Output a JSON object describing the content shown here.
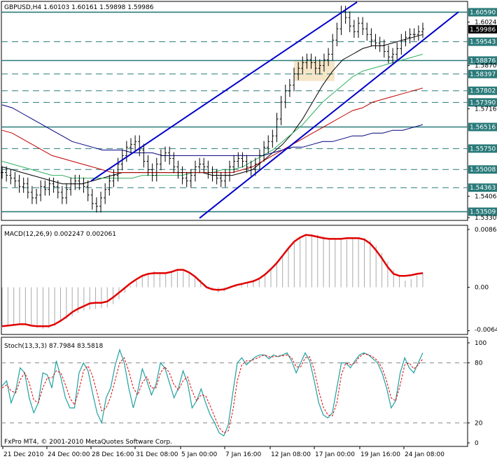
{
  "chart_data": [
    {
      "type": "line",
      "panel": "price",
      "title": "GBPUSD,H4  1.60103 1.60161 1.59898 1.59986",
      "ohlc": {
        "open": 1.60103,
        "high": 1.60161,
        "low": 1.59898,
        "close": 1.59986
      },
      "ylim": [
        1.5325,
        1.609
      ],
      "y_tick_labels": [
        "1.60240",
        "1.59986",
        "1.59543",
        "1.58876",
        "1.58700",
        "1.58397",
        "1.57802",
        "1.57390",
        "1.57160",
        "1.56516",
        "1.55750",
        "1.55008",
        "1.54060",
        "1.54363",
        "1.53509",
        "1.53300"
      ],
      "horizontal_levels": [
        {
          "label": "1.60590",
          "value": 1.6059,
          "style": "solid"
        },
        {
          "label": "1.59543",
          "value": 1.59543,
          "style": "dashed"
        },
        {
          "label": "1.58876",
          "value": 1.58876,
          "style": "solid"
        },
        {
          "label": "1.58397",
          "value": 1.58397,
          "style": "dashed"
        },
        {
          "label": "1.57802",
          "value": 1.57802,
          "style": "dashed"
        },
        {
          "label": "1.57390",
          "value": 1.5739,
          "style": "dashed"
        },
        {
          "label": "1.56516",
          "value": 1.56516,
          "style": "solid"
        },
        {
          "label": "1.55750",
          "value": 1.5575,
          "style": "dashed"
        },
        {
          "label": "1.55008",
          "value": 1.55008,
          "style": "dashed"
        },
        {
          "label": "1.54363",
          "value": 1.54363,
          "style": "dashed"
        },
        {
          "label": "1.53509",
          "value": 1.53509,
          "style": "solid"
        }
      ],
      "current_price": {
        "label": "1.59986",
        "value": 1.59986
      },
      "close_series": [
        1.549,
        1.548,
        1.547,
        1.546,
        1.544,
        1.545,
        1.542,
        1.54,
        1.541,
        1.544,
        1.543,
        1.545,
        1.544,
        1.542,
        1.54,
        1.543,
        1.545,
        1.546,
        1.545,
        1.544,
        1.541,
        1.538,
        1.537,
        1.54,
        1.543,
        1.546,
        1.548,
        1.552,
        1.555,
        1.558,
        1.559,
        1.56,
        1.557,
        1.553,
        1.55,
        1.548,
        1.552,
        1.555,
        1.556,
        1.554,
        1.551,
        1.549,
        1.547,
        1.546,
        1.548,
        1.551,
        1.552,
        1.551,
        1.549,
        1.548,
        1.547,
        1.546,
        1.548,
        1.551,
        1.553,
        1.554,
        1.553,
        1.551,
        1.55,
        1.552,
        1.555,
        1.558,
        1.56,
        1.562,
        1.568,
        1.574,
        1.578,
        1.58,
        1.584,
        1.586,
        1.588,
        1.589,
        1.588,
        1.586,
        1.587,
        1.589,
        1.591,
        1.596,
        1.6,
        1.606,
        1.604,
        1.601,
        1.599,
        1.602,
        1.6,
        1.598,
        1.596,
        1.595,
        1.594,
        1.592,
        1.59,
        1.591,
        1.593,
        1.596,
        1.597,
        1.598,
        1.598,
        1.599,
        1.6
      ],
      "moving_averages": [
        {
          "color": "#000000",
          "values": [
            1.551,
            1.55,
            1.549,
            1.548,
            1.547,
            1.546,
            1.545,
            1.545,
            1.545,
            1.546,
            1.547,
            1.548,
            1.549,
            1.549,
            1.549,
            1.549,
            1.549,
            1.549,
            1.549,
            1.549,
            1.549,
            1.548,
            1.548,
            1.548,
            1.549,
            1.55,
            1.553,
            1.556,
            1.559,
            1.563,
            1.568,
            1.574,
            1.58,
            1.585,
            1.589,
            1.591,
            1.593,
            1.594,
            1.594,
            1.595,
            1.596,
            1.597,
            1.598
          ]
        },
        {
          "color": "#30b060",
          "values": [
            1.553,
            1.552,
            1.551,
            1.55,
            1.549,
            1.548,
            1.548,
            1.547,
            1.547,
            1.547,
            1.547,
            1.547,
            1.547,
            1.547,
            1.548,
            1.548,
            1.548,
            1.548,
            1.548,
            1.549,
            1.549,
            1.549,
            1.55,
            1.55,
            1.551,
            1.553,
            1.555,
            1.557,
            1.56,
            1.563,
            1.566,
            1.57,
            1.574,
            1.577,
            1.58,
            1.583,
            1.585,
            1.586,
            1.587,
            1.588,
            1.589,
            1.59,
            1.591
          ]
        },
        {
          "color": "#c00000",
          "values": [
            1.564,
            1.563,
            1.561,
            1.559,
            1.557,
            1.555,
            1.554,
            1.553,
            1.552,
            1.551,
            1.55,
            1.549,
            1.549,
            1.549,
            1.549,
            1.549,
            1.549,
            1.549,
            1.549,
            1.549,
            1.549,
            1.549,
            1.549,
            1.549,
            1.55,
            1.551,
            1.553,
            1.555,
            1.557,
            1.559,
            1.561,
            1.563,
            1.565,
            1.567,
            1.569,
            1.571,
            1.572,
            1.574,
            1.575,
            1.576,
            1.577,
            1.578,
            1.579
          ]
        },
        {
          "color": "#000080",
          "values": [
            1.573,
            1.572,
            1.57,
            1.568,
            1.566,
            1.564,
            1.562,
            1.56,
            1.559,
            1.558,
            1.557,
            1.557,
            1.557,
            1.556,
            1.556,
            1.556,
            1.555,
            1.555,
            1.555,
            1.555,
            1.555,
            1.555,
            1.555,
            1.555,
            1.555,
            1.555,
            1.555,
            1.556,
            1.557,
            1.558,
            1.558,
            1.559,
            1.56,
            1.56,
            1.561,
            1.562,
            1.562,
            1.563,
            1.563,
            1.564,
            1.564,
            1.565,
            1.566
          ]
        }
      ]
    },
    {
      "type": "bar",
      "panel": "macd",
      "title": "MACD(12,26,9) 0.002247 0.002061",
      "values": {
        "main": 0.002247,
        "signal": 0.002061
      },
      "ylim": [
        -0.0066,
        0.0088
      ],
      "y_tick_labels": [
        "0.00860",
        "0.00",
        "-0.00646"
      ],
      "histogram": [
        -0.0058,
        -0.0057,
        -0.0055,
        -0.0054,
        -0.0056,
        -0.0058,
        -0.006,
        -0.0062,
        -0.0061,
        -0.0058,
        -0.0052,
        -0.0047,
        -0.0043,
        -0.0038,
        -0.0035,
        -0.0033,
        -0.0032,
        -0.0031,
        -0.003,
        -0.0025,
        -0.0018,
        -0.0008,
        0.0002,
        0.001,
        0.0016,
        0.002,
        0.0024,
        0.0022,
        0.0021,
        0.0022,
        0.0025,
        0.0026,
        0.0022,
        0.0016,
        0.0011,
        0.0002,
        -0.0004,
        -0.0008,
        -0.0006,
        -0.0002,
        0.0003,
        0.0006,
        0.0008,
        0.0011,
        0.0014,
        0.002,
        0.0028,
        0.0036,
        0.0046,
        0.0058,
        0.0068,
        0.0075,
        0.0078,
        0.0079,
        0.0078,
        0.0076,
        0.0073,
        0.0072,
        0.0071,
        0.0071,
        0.0072,
        0.0073,
        0.0073,
        0.007,
        0.0062,
        0.0051,
        0.0038,
        0.0026,
        0.0016,
        0.001,
        0.0012,
        0.0018,
        0.0022
      ],
      "signal_line": [
        -0.0058,
        -0.0057,
        -0.0056,
        -0.0055,
        -0.0055,
        -0.0057,
        -0.0058,
        -0.0058,
        -0.0058,
        -0.0055,
        -0.005,
        -0.0044,
        -0.0037,
        -0.0032,
        -0.0028,
        -0.0024,
        -0.0023,
        -0.0023,
        -0.0021,
        -0.0015,
        -0.0008,
        -0.0001,
        0.0006,
        0.0012,
        0.0017,
        0.002,
        0.0021,
        0.0021,
        0.0021,
        0.0023,
        0.0026,
        0.0026,
        0.0022,
        0.0016,
        0.0008,
        0.0,
        -0.0003,
        -0.0004,
        -0.0003,
        0.0,
        0.0003,
        0.0005,
        0.0007,
        0.0009,
        0.0013,
        0.0019,
        0.0027,
        0.0036,
        0.0047,
        0.0058,
        0.0068,
        0.0074,
        0.0078,
        0.0077,
        0.0075,
        0.0073,
        0.0072,
        0.0072,
        0.0072,
        0.0073,
        0.0073,
        0.0073,
        0.0071,
        0.0065,
        0.0055,
        0.0043,
        0.003,
        0.002,
        0.0017,
        0.0017,
        0.0018,
        0.002,
        0.0021
      ]
    },
    {
      "type": "line",
      "panel": "stochastic",
      "title": "Stoch(13,3,3) 87.7984 83.5818",
      "values": {
        "main": 87.7984,
        "signal": 83.5818
      },
      "ylim": [
        0,
        100
      ],
      "y_tick_labels": [
        "100",
        "80",
        "20",
        "0"
      ],
      "main": [
        57,
        62,
        40,
        52,
        75,
        70,
        45,
        30,
        40,
        70,
        68,
        55,
        82,
        65,
        45,
        35,
        35,
        70,
        80,
        72,
        50,
        30,
        20,
        45,
        55,
        78,
        93,
        80,
        55,
        35,
        52,
        74,
        62,
        48,
        58,
        80,
        75,
        60,
        45,
        55,
        72,
        60,
        35,
        42,
        54,
        40,
        28,
        20,
        10,
        7,
        18,
        50,
        80,
        85,
        78,
        82,
        86,
        88,
        88,
        84,
        88,
        86,
        88,
        90,
        82,
        70,
        80,
        90,
        82,
        62,
        40,
        28,
        25,
        30,
        55,
        80,
        80,
        75,
        82,
        88,
        90,
        88,
        84,
        80,
        70,
        55,
        35,
        42,
        70,
        85,
        75,
        70,
        80,
        90
      ],
      "signal": [
        55,
        58,
        52,
        50,
        63,
        70,
        60,
        43,
        40,
        55,
        65,
        65,
        72,
        70,
        58,
        45,
        38,
        53,
        72,
        77,
        67,
        50,
        32,
        35,
        46,
        63,
        80,
        85,
        72,
        55,
        48,
        60,
        66,
        55,
        55,
        70,
        76,
        70,
        58,
        53,
        62,
        66,
        52,
        42,
        48,
        47,
        37,
        26,
        15,
        10,
        12,
        32,
        62,
        78,
        82,
        82,
        84,
        86,
        88,
        86,
        86,
        87,
        87,
        88,
        85,
        76,
        76,
        85,
        86,
        73,
        52,
        36,
        28,
        27,
        40,
        68,
        80,
        78,
        80,
        86,
        89,
        88,
        86,
        82,
        75,
        62,
        45,
        42,
        58,
        78,
        80,
        74,
        78,
        84
      ]
    },
    {
      "type": "table",
      "panel": "time-axis",
      "x_tick_labels": [
        "21 Dec 2010",
        "24 Dec 00:00",
        "28 Dec 16:00",
        "31 Dec 08:00",
        "5 Jan 00:00",
        "7 Jan 16:00",
        "12 Jan 08:00",
        "17 Jan 00:00",
        "19 Jan 16:00",
        "24 Jan 08:00"
      ]
    }
  ],
  "footer": {
    "copyright": "FxPro MT4, © 2001-2010 MetaQuotes Software Corp."
  },
  "colors": {
    "axis": "#000000",
    "grid_level": "#2a7a7a",
    "channel": "#0000cc",
    "macd_hist": "#a9a9a9",
    "macd_signal": "#e00000",
    "stoch_main": "#20a0a0",
    "stoch_signal": "#e00000",
    "highlight_box": "#f6e6c8"
  }
}
